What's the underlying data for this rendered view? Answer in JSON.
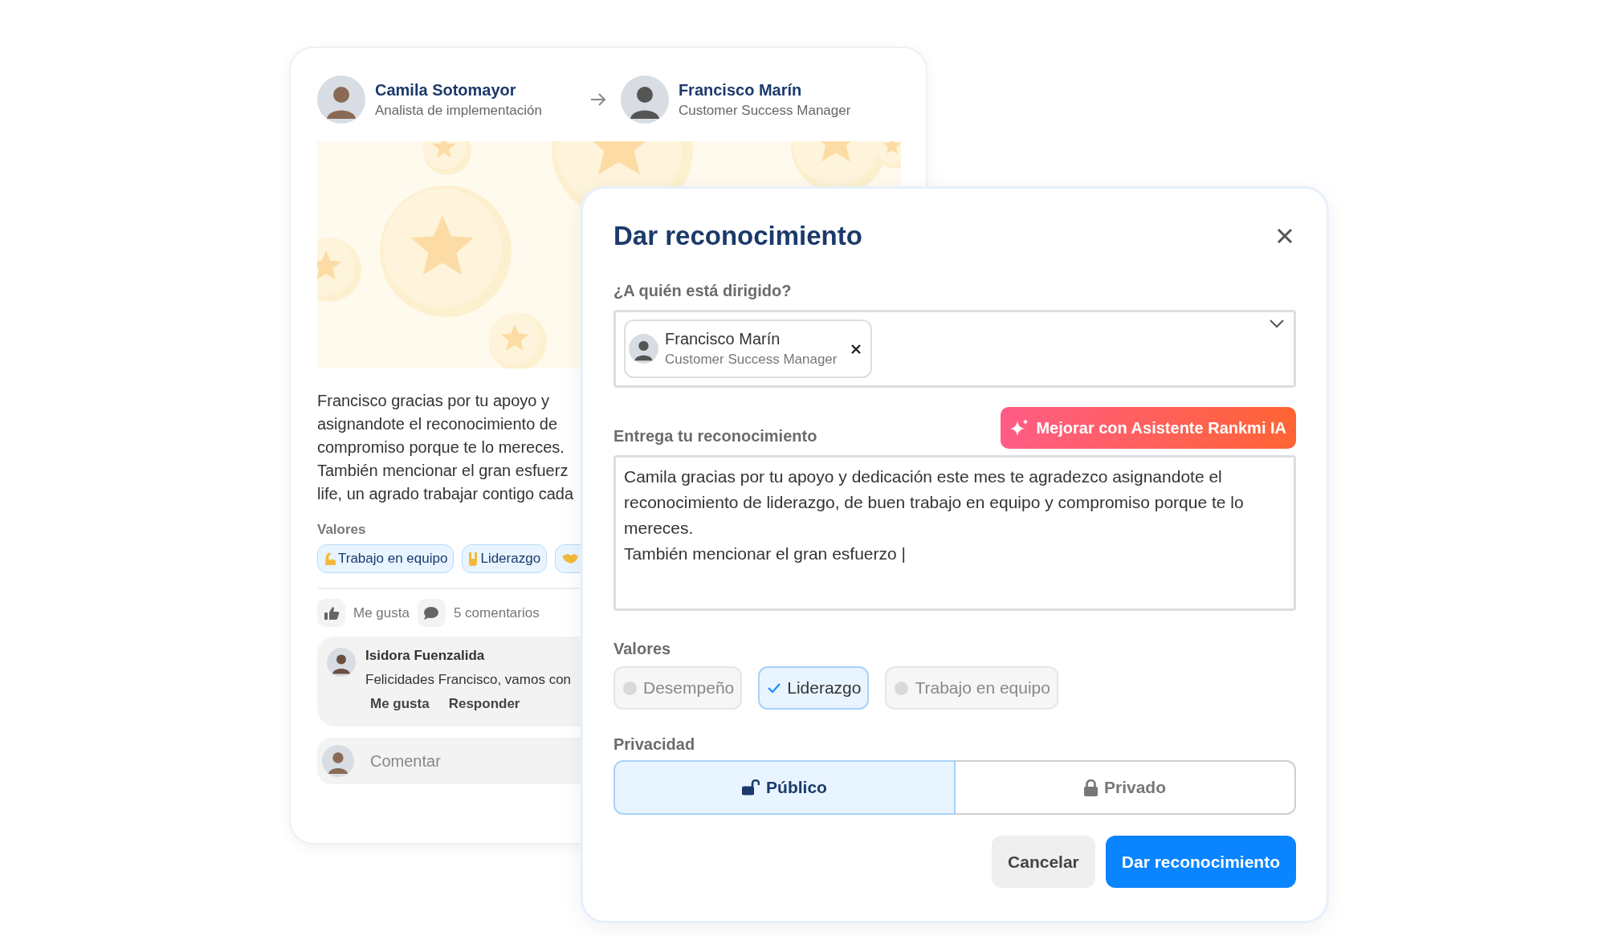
{
  "post": {
    "author": {
      "name": "Camila Sotomayor",
      "role": "Analista de implementación"
    },
    "recipient": {
      "name": "Francisco Marín",
      "role": "Customer Success Manager"
    },
    "body_lines": [
      "Francisco gracias por tu apoyo y",
      "asignandote el reconocimiento de",
      "compromiso porque te lo mereces.",
      "También mencionar el gran esfuerz",
      "life, un agrado trabajar contigo cada"
    ],
    "values_label": "Valores",
    "values": [
      {
        "label": "Trabajo en equipo",
        "kind": "arm"
      },
      {
        "label": "Liderazgo",
        "kind": "rock"
      },
      {
        "kind": "handshake"
      }
    ],
    "actions": [
      {
        "kind": "like",
        "label": "Me gusta"
      },
      {
        "kind": "comment",
        "label": "5 comentarios"
      }
    ],
    "comment": {
      "author": "Isidora Fuenzalida",
      "text": "Felicidades Francisco, vamos con",
      "actions": [
        "Me gusta",
        "Responder"
      ]
    },
    "comment_input": {
      "placeholder": "Comentar"
    }
  },
  "dialog": {
    "title": "Dar reconocimiento",
    "recipient_label": "¿A quién está dirigido?",
    "recipient": {
      "name": "Francisco Marín",
      "role": "Customer Success Manager"
    },
    "message_label": "Entrega tu reconocimiento",
    "ai_button": "Mejorar con Asistente Rankmi IA",
    "message": "Camila gracias por tu apoyo y dedicación este mes te agradezco asignandote el reconocimiento de liderazgo, de buen trabajo en equipo y compromiso porque te lo mereces.\nTambién mencionar el gran esfuerzo |",
    "values_label": "Valores",
    "values": [
      {
        "label": "Desempeño",
        "selected": false
      },
      {
        "label": "Liderazgo",
        "selected": true
      },
      {
        "label": "Trabajo en equipo",
        "selected": false
      }
    ],
    "privacy_label": "Privacidad",
    "privacy": [
      {
        "label": "Público",
        "kind": "public",
        "selected": true
      },
      {
        "label": "Privado",
        "kind": "private",
        "selected": false
      }
    ],
    "buttons": [
      {
        "label": "Cancelar",
        "kind": "secondary"
      },
      {
        "label": "Dar reconocimiento",
        "kind": "primary"
      }
    ]
  }
}
